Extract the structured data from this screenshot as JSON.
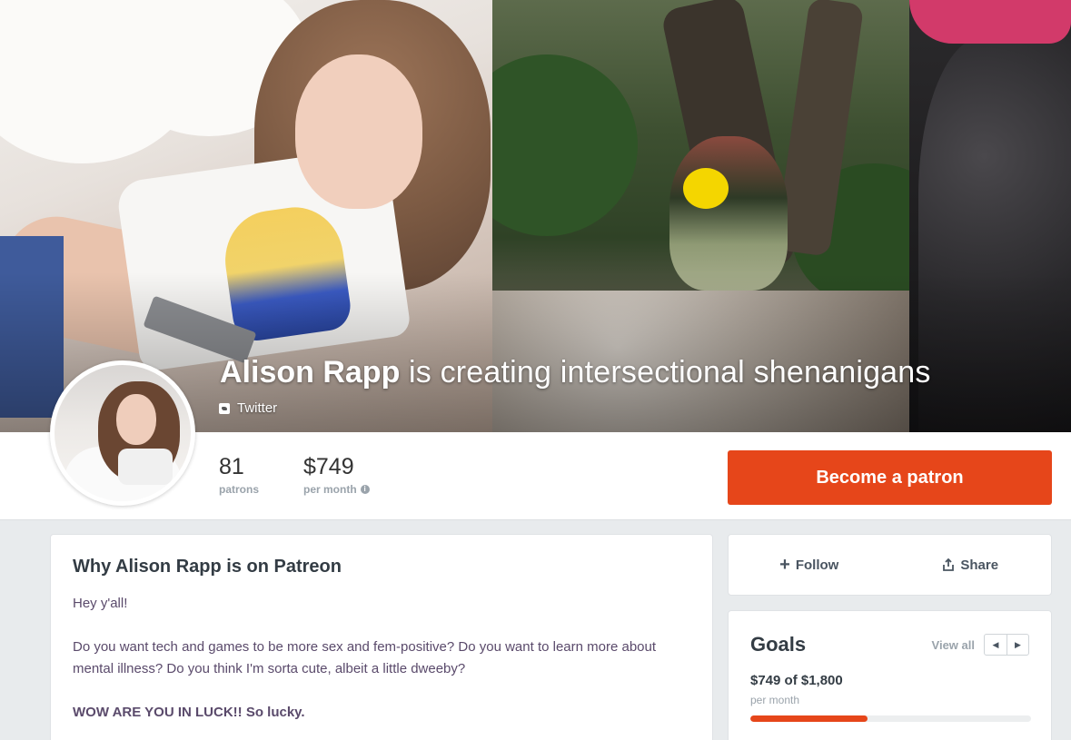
{
  "creator": {
    "name": "Alison Rapp",
    "tagline": " is creating intersectional shenanigans",
    "social_link": "Twitter"
  },
  "stats": {
    "patrons_value": "81",
    "patrons_label": "patrons",
    "earnings_value": "$749",
    "earnings_label": "per month"
  },
  "cta": {
    "become_patron": "Become a patron"
  },
  "actions": {
    "follow": "Follow",
    "share": "Share"
  },
  "about": {
    "title": "Why Alison Rapp is on Patreon",
    "paragraph1": "Hey y'all!",
    "paragraph2": "Do you want tech and games to be more sex and fem-positive? Do you want to learn more about mental illness? Do you think I'm sorta cute, albeit a little dweeby?",
    "paragraph3": "WOW ARE YOU IN LUCK!! So lucky."
  },
  "goals": {
    "title": "Goals",
    "view_all": "View all",
    "amount": "$749 of $1,800",
    "period": "per month",
    "progress_fraction": 0.416
  },
  "colors": {
    "accent": "#e6461a",
    "text_dark": "#333c44",
    "text_muted": "#9aa3ab",
    "about_text": "#5a4a6b"
  }
}
